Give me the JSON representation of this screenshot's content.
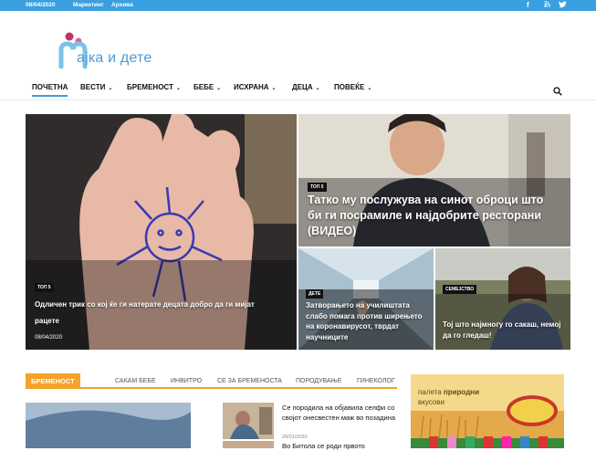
{
  "topbar": {
    "date": "08/04/2020",
    "links": [
      "Маркетинг",
      "Архива"
    ],
    "social": [
      "facebook-icon",
      "rss-icon",
      "twitter-icon"
    ],
    "bg_color": "#3a9fe0"
  },
  "logo": {
    "text": "ајка и дете"
  },
  "nav": {
    "items": [
      {
        "label": "ПОЧЕТНА",
        "active": true
      },
      {
        "label": "ВЕСТИ",
        "dropdown": true
      },
      {
        "label": "БРЕМЕНОСТ",
        "dropdown": true
      },
      {
        "label": "БЕБЕ",
        "dropdown": true
      },
      {
        "label": "ИСХРАНА",
        "dropdown": true
      },
      {
        "label": "ДЕЦА",
        "dropdown": true
      },
      {
        "label": "ПОВЕЌЕ",
        "dropdown": true
      }
    ],
    "caret": "⌄"
  },
  "featured": [
    {
      "category": "ТОП 5",
      "title": "Одличен трик со кој ќе ги натерате децата добро да ги мијат рацете",
      "date": "08/04/2020"
    },
    {
      "category": "ТОП 5",
      "title": "Татко му послужува на синот оброци што би ги посрамиле и најдобрите ресторани (ВИДЕО)"
    },
    {
      "category": "ДЕТЕ",
      "title": "Затворањето на училиштата слабо помага против ширењето на коронавирусот, тврдат научниците"
    },
    {
      "category": "СЕМЕЈСТВО",
      "title": "Тој што најмногу го сакаш, немој да го гледаш!"
    }
  ],
  "section": {
    "badge": "БРЕМЕНОСТ",
    "tabs": [
      "САКАМ БЕБЕ",
      "ИНВИТРО",
      "СЕ ЗА БРЕМЕНОСТА",
      "ПОРОДУВАЊЕ",
      "ГИНЕКОЛОГ"
    ],
    "accent": "#f4a22c"
  },
  "posts": [
    {
      "title": "Се породила на објавила селфи со својот онесвестен маж во позадина",
      "date": "29/01/2020"
    },
    {
      "title": "Во Битола се роди првото"
    }
  ],
  "ad": {
    "line1": "палета ",
    "line1_bold": "природни",
    "line2": "вкусови"
  }
}
